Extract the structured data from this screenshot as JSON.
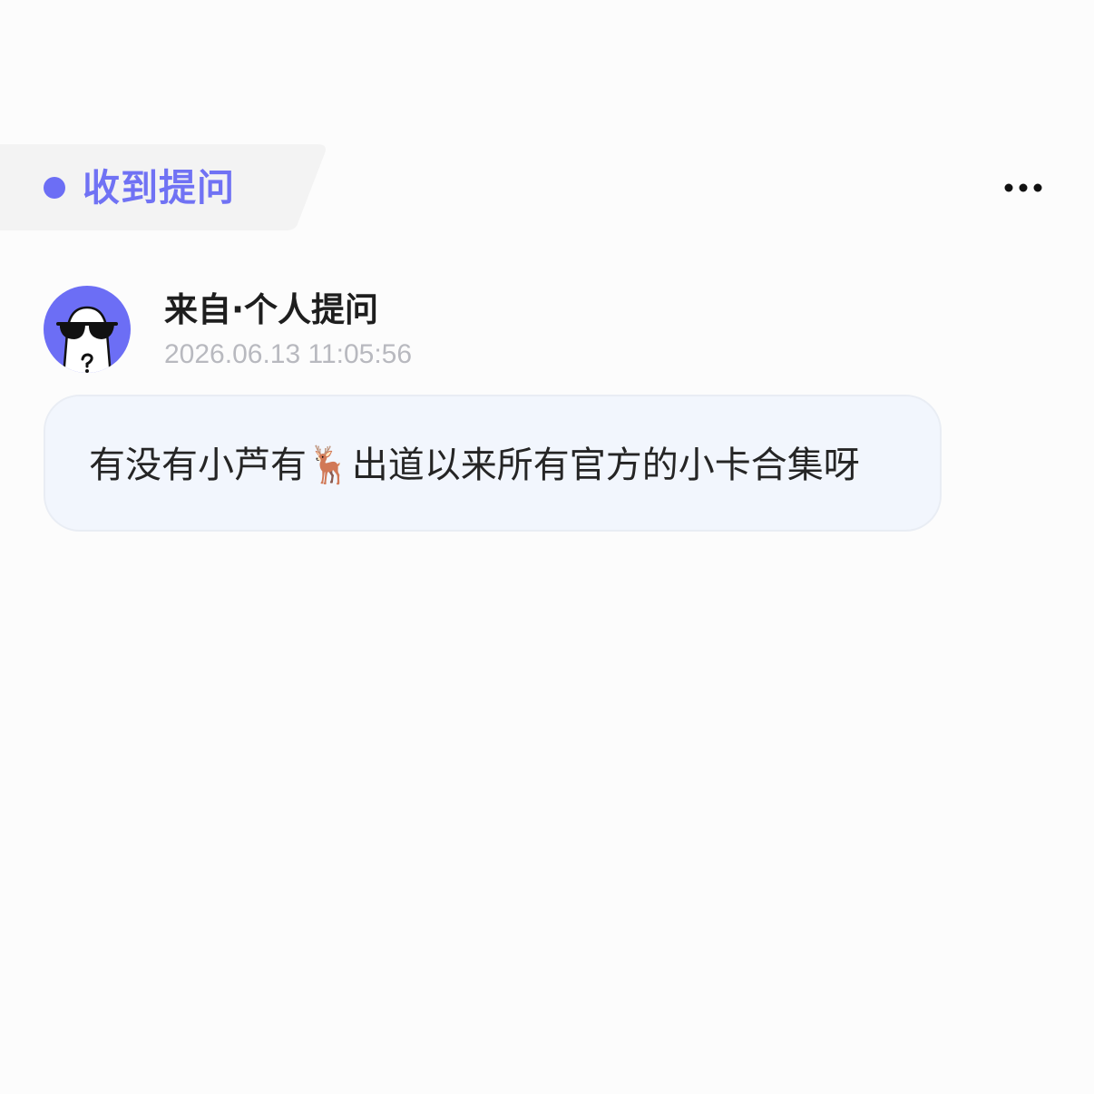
{
  "header": {
    "tab_label": "收到提问",
    "accent_color": "#6c6ef5",
    "more_icon": "more-horizontal-icon"
  },
  "question": {
    "avatar_icon": "anonymous-sunglasses-avatar",
    "source": "来自·个人提问",
    "timestamp": "2026.06.13 11:05:56",
    "text": "有没有小芦有🦌出道以来所有官方的小卡合集呀"
  }
}
